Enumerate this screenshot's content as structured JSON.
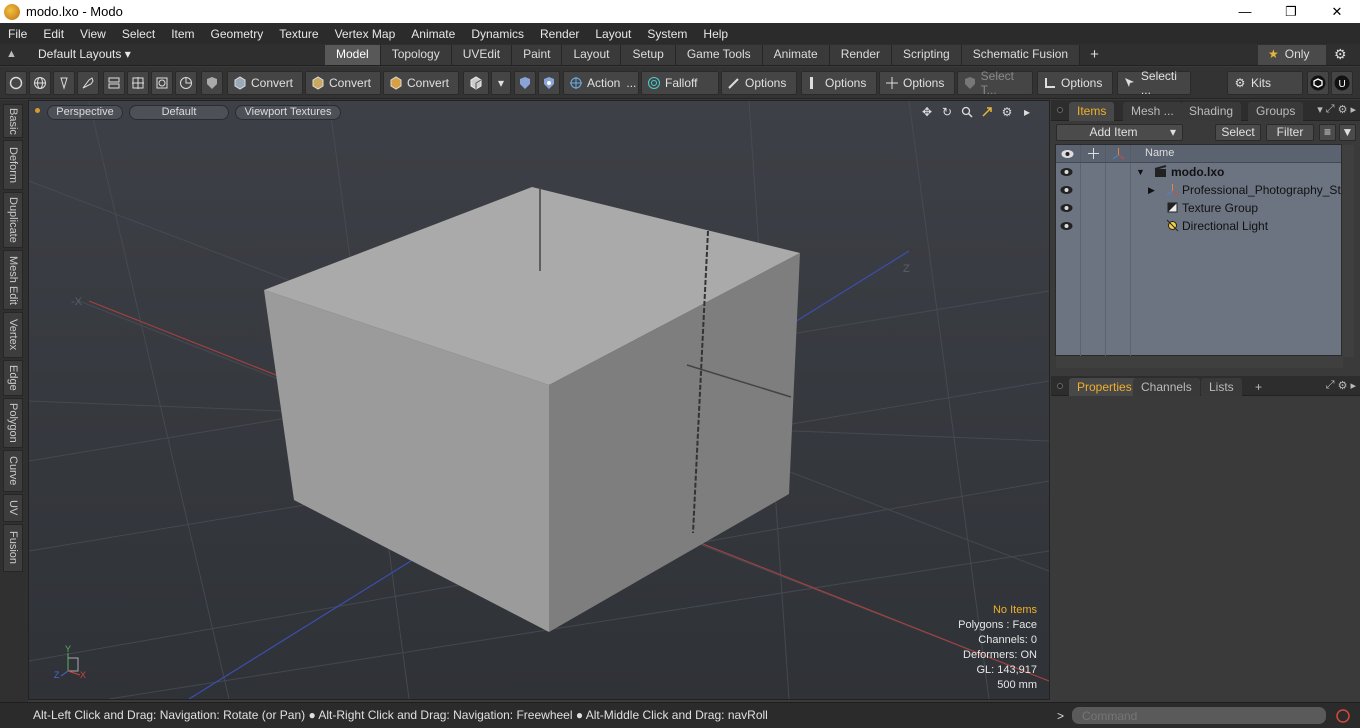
{
  "window": {
    "title": "modo.lxo - Modo",
    "minimize": "—",
    "maximize": "❐",
    "close": "✕"
  },
  "menubar": [
    "File",
    "Edit",
    "View",
    "Select",
    "Item",
    "Geometry",
    "Texture",
    "Vertex Map",
    "Animate",
    "Dynamics",
    "Render",
    "Layout",
    "System",
    "Help"
  ],
  "tabbar": {
    "layouts": "Default Layouts ▾",
    "tabs": [
      "Model",
      "Topology",
      "UVEdit",
      "Paint",
      "Layout",
      "Setup",
      "Game Tools",
      "Animate",
      "Render",
      "Scripting",
      "Schematic Fusion"
    ],
    "active_tab": "Model",
    "add": "+",
    "only": "Only"
  },
  "toolbar": {
    "convert1": "Convert",
    "convert2": "Convert",
    "convert3": "Convert",
    "action": "Action",
    "action_more": "...",
    "falloff": "Falloff",
    "options1": "Options",
    "options2": "Options",
    "options3": "Options",
    "select_t": "Select T...",
    "options4": "Options",
    "selecti": "Selecti ...",
    "kits": "Kits"
  },
  "left_tabs": [
    "Basic",
    "Deform",
    "Duplicate",
    "Mesh Edit",
    "Vertex",
    "Edge",
    "Polygon",
    "Curve",
    "UV",
    "Fusion"
  ],
  "viewport": {
    "view": "Perspective",
    "style": "Default",
    "shading": "Viewport Textures",
    "axis_neg_x": "-X",
    "axis_z": "Z",
    "hud": {
      "selection": "No Items",
      "polygons": "Polygons : Face",
      "channels": "Channels: 0",
      "deformers": "Deformers: ON",
      "gl": "GL: 143,917",
      "grid": "500 mm"
    },
    "gizmo": {
      "y": "Y",
      "z": "Z",
      "x": "X"
    }
  },
  "items_panel": {
    "tabs": [
      "Items",
      "Mesh ...",
      "Shading",
      "Groups"
    ],
    "active_tab": "Items",
    "add_item": "Add Item",
    "select": "Select",
    "filter": "Filter",
    "name_header": "Name",
    "rows": [
      {
        "label": "modo.lxo",
        "bold": true
      },
      {
        "label": "Professional_Photography_St ...",
        "bold": false
      },
      {
        "label": "Texture Group",
        "bold": false
      },
      {
        "label": "Directional Light",
        "bold": false
      }
    ]
  },
  "properties_panel": {
    "tabs": [
      "Properties",
      "Channels",
      "Lists"
    ],
    "active_tab": "Properties",
    "add": "+"
  },
  "statusbar": {
    "hint1": "Alt-Left Click and Drag: Navigation: Rotate (or Pan)",
    "hint2": "Alt-Right Click and Drag: Navigation: Freewheel",
    "hint3": "Alt-Middle Click and Drag: navRoll",
    "command_placeholder": "Command"
  },
  "colors": {
    "accent": "#f0b02a",
    "cube_top": "#a9a9a9",
    "cube_left": "#9a9a9a",
    "cube_right": "#7d7d7d",
    "items_bg": "#6c7482"
  }
}
